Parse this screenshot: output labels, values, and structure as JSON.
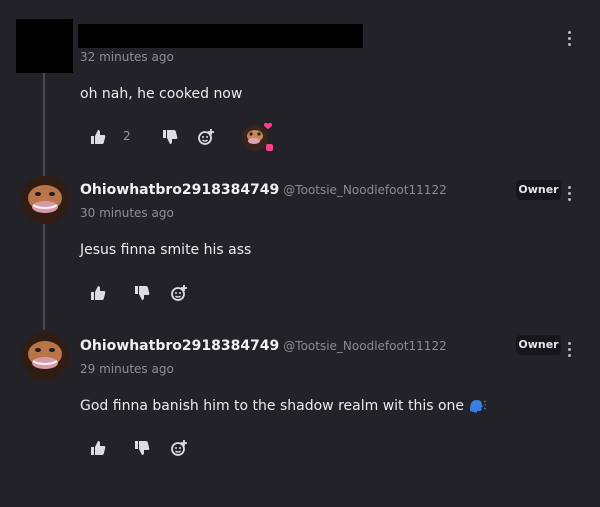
{
  "colors": {
    "background": "#232229",
    "thread_line": "#4a4952",
    "badge_bg": "#17161b",
    "heart_accent": "#ff3f8e"
  },
  "comments": [
    {
      "author": "",
      "handle": "",
      "redacted": true,
      "timestamp": "32 minutes ago",
      "text": "oh nah, he cooked now",
      "like_count": "2",
      "has_reaction": true
    },
    {
      "author": "Ohiowhatbro2918384749",
      "handle": "@Tootsie_Noodlefoot11122",
      "badge": "Owner",
      "timestamp": "30 minutes ago",
      "text": "Jesus finna smite his ass"
    },
    {
      "author": "Ohiowhatbro2918384749",
      "handle": "@Tootsie_Noodlefoot11122",
      "badge": "Owner",
      "timestamp": "29 minutes ago",
      "text": "God finna banish him to the shadow realm wit this one",
      "trailing_icon": "speaking-head-icon"
    }
  ],
  "icons": {
    "like": "thumbs-up-icon",
    "dislike": "thumbs-down-icon",
    "react": "add-reaction-icon",
    "more": "more-vertical-icon"
  }
}
